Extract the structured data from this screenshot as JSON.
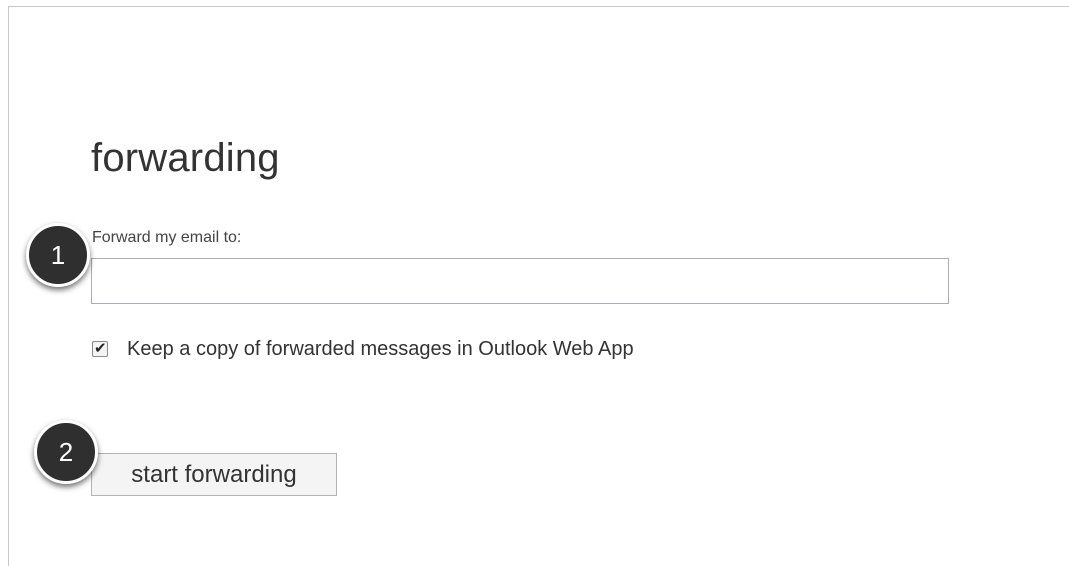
{
  "forwarding": {
    "title": "forwarding",
    "forward_label": "Forward my email to:",
    "forward_input": {
      "value": "",
      "placeholder": ""
    },
    "keep_copy": {
      "checked": true,
      "label": "Keep a copy of forwarded messages in Outlook Web App"
    },
    "start_button_label": "start forwarding"
  },
  "callouts": [
    {
      "number": "1"
    },
    {
      "number": "2"
    }
  ],
  "icons": {
    "check": "check-icon"
  },
  "colors": {
    "callout_fill": "#2f2f2f",
    "callout_border": "#ffffff",
    "input_border": "#a8aeb4",
    "button_background": "#f4f4f4"
  }
}
